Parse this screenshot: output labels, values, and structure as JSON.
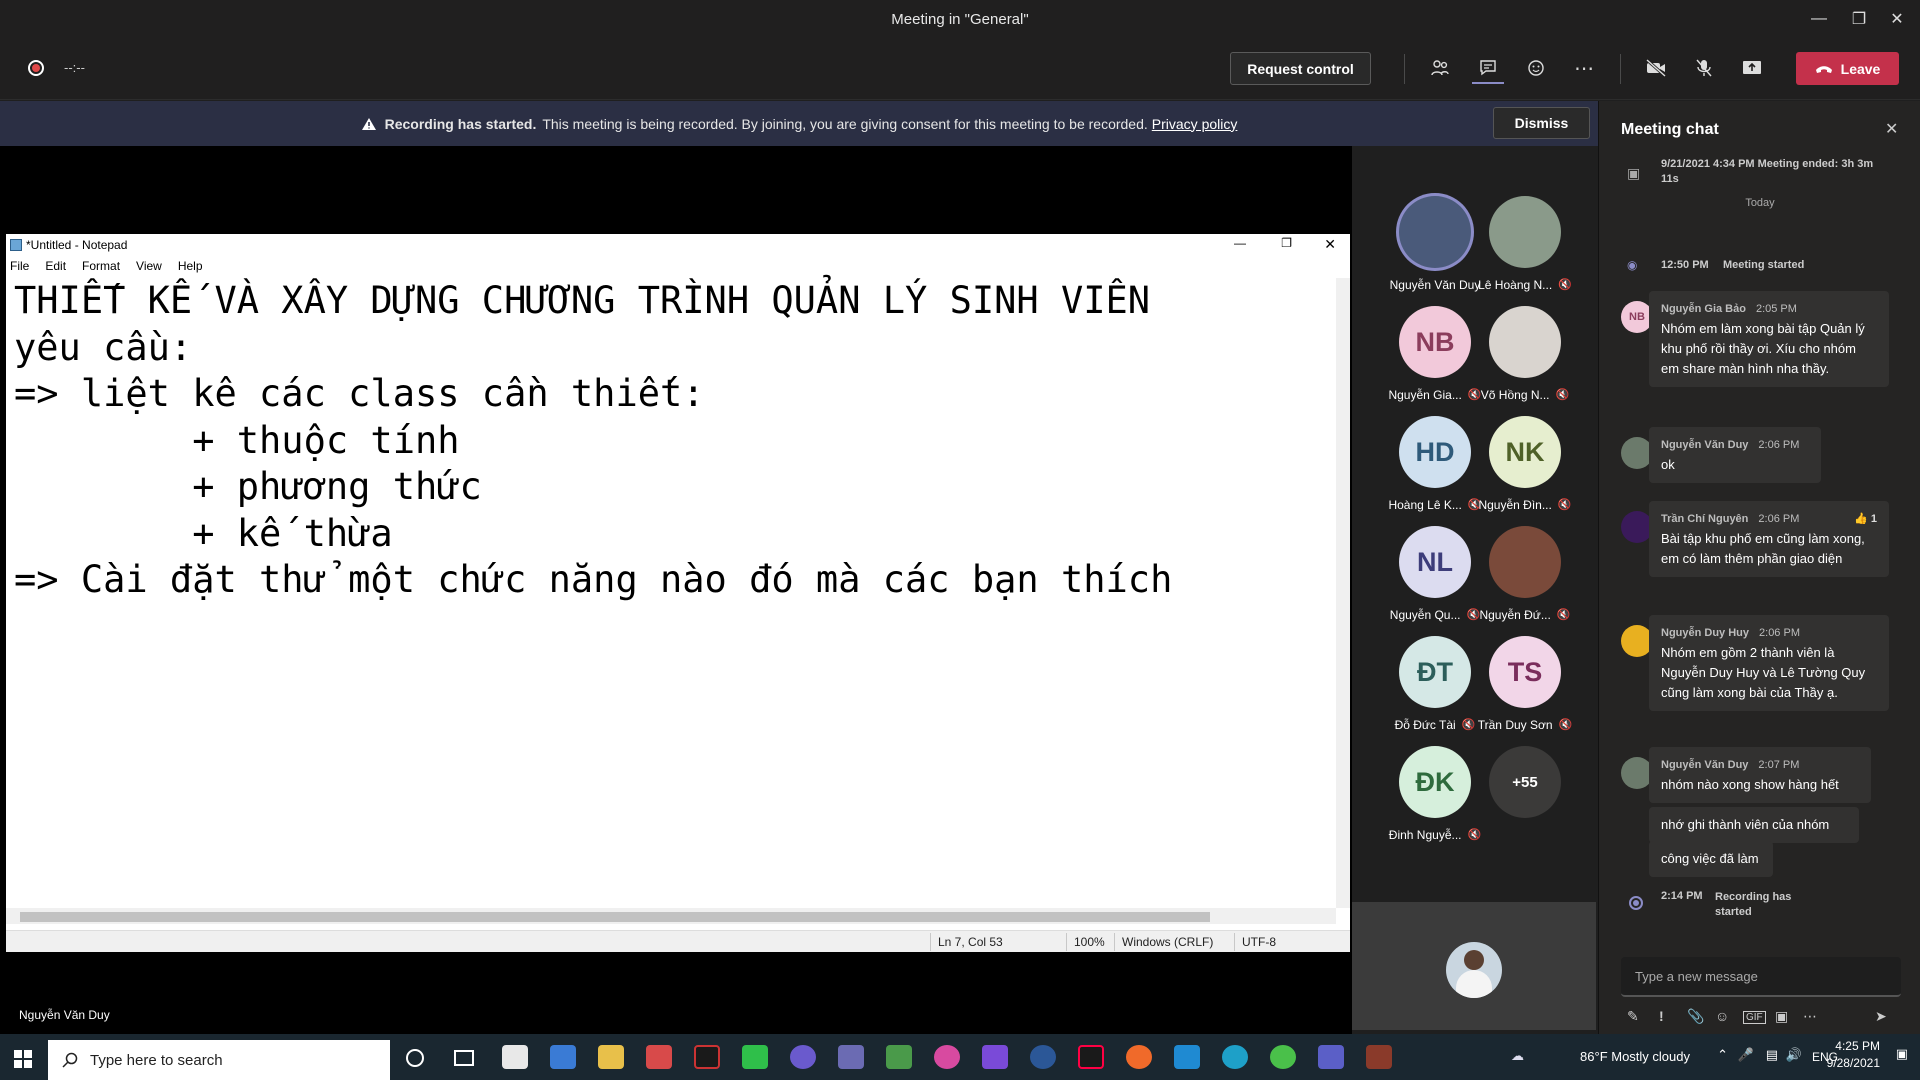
{
  "window": {
    "title": "Meeting in \"General\""
  },
  "toolbar": {
    "timer": "--:--",
    "request_control": "Request control",
    "leave": "Leave"
  },
  "banner": {
    "bold": "Recording has started.",
    "text": "This meeting is being recorded. By joining, you are giving consent for this meeting to be recorded.",
    "link": "Privacy policy",
    "dismiss": "Dismiss"
  },
  "notepad": {
    "title": "*Untitled - Notepad",
    "menu": [
      "File",
      "Edit",
      "Format",
      "View",
      "Help"
    ],
    "lines": [
      "THIẾT KẾ VÀ XÂY DỰNG CHƯƠNG TRÌNH QUẢN LÝ SINH VIÊN",
      "yêu cầu:",
      "=> liệt kê các class cần thiết:",
      "        + thuộc tính",
      "        + phương thức",
      "        + kế thừa",
      "=> Cài đặt thử một chức năng nào đó mà các bạn thích"
    ],
    "status": {
      "position": "Ln 7, Col 53",
      "zoom": "100%",
      "eol": "Windows (CRLF)",
      "encoding": "UTF-8"
    }
  },
  "presenter_name": "Nguyễn Văn Duy",
  "participants": [
    {
      "name": "Nguyễn Văn Duy",
      "initials": "",
      "bg": "#4a5a7a",
      "muted": false
    },
    {
      "name": "Lê Hoàng N...",
      "initials": "",
      "bg": "#8a9a8a",
      "muted": true
    },
    {
      "name": "Nguyễn Gia...",
      "initials": "NB",
      "bg": "#f2c9da",
      "fg": "#8b3d5c",
      "muted": true
    },
    {
      "name": "Võ Hồng N...",
      "initials": "",
      "bg": "#d9d4cf",
      "muted": true
    },
    {
      "name": "Hoàng Lê K...",
      "initials": "HD",
      "bg": "#cfe0ef",
      "fg": "#2e5a7a",
      "muted": true
    },
    {
      "name": "Nguyễn Đìn...",
      "initials": "NK",
      "bg": "#e6eecf",
      "fg": "#4f6128",
      "muted": true
    },
    {
      "name": "Nguyễn Qu...",
      "initials": "NL",
      "bg": "#dcdcf0",
      "fg": "#3d3d7a",
      "muted": true
    },
    {
      "name": "Nguyễn Đứ...",
      "initials": "",
      "bg": "#7a4a3a",
      "muted": true
    },
    {
      "name": "Đỗ Đức Tài",
      "initials": "ĐT",
      "bg": "#d5e8e6",
      "fg": "#2c5e5a",
      "muted": true
    },
    {
      "name": "Trần Duy Sơn",
      "initials": "TS",
      "bg": "#f2d6e8",
      "fg": "#7a2d5c",
      "muted": true
    },
    {
      "name": "Đinh Nguyễ...",
      "initials": "ĐK",
      "bg": "#d6efdc",
      "fg": "#2e6b3d",
      "muted": true
    },
    {
      "name": "",
      "initials": "+55",
      "bg": "#3b3a39",
      "fg": "#ffffff",
      "muted": false
    }
  ],
  "chat": {
    "header": "Meeting chat",
    "system1": "9/21/2021 4:34 PM   Meeting ended: 3h 3m 11s",
    "today": "Today",
    "system2_time": "12:50 PM",
    "system2_text": "Meeting started",
    "messages": [
      {
        "sender": "Nguyễn Gia Bảo",
        "time": "2:05 PM",
        "avatar": "NB",
        "text": "Nhóm em làm xong bài tập Quản lý khu phố rồi thầy ơi. Xíu cho nhóm em share màn hình nha thầy."
      },
      {
        "sender": "Nguyễn Văn Duy",
        "time": "2:06 PM",
        "avatar": "",
        "text": "ok"
      },
      {
        "sender": "Trần Chí Nguyên",
        "time": "2:06 PM",
        "avatar": "",
        "text": "Bài tập khu phố em cũng làm xong, em có làm thêm phần giao diện",
        "reaction": "1"
      },
      {
        "sender": "Nguyễn Duy Huy",
        "time": "2:06 PM",
        "avatar": "",
        "text": "Nhóm em gồm 2 thành viên là Nguyễn Duy Huy và Lê Tường Quy cũng làm xong bài của Thầy ạ."
      },
      {
        "sender": "Nguyễn Văn Duy",
        "time": "2:07 PM",
        "avatar": "",
        "text": "nhóm nào xong show hàng hết"
      }
    ],
    "followups": [
      "nhớ ghi thành viên của nhóm",
      "công việc đã làm"
    ],
    "system3_time": "2:14 PM",
    "system3_text": "Recording has started",
    "compose_placeholder": "Type a new message"
  },
  "taskbar": {
    "search_placeholder": "Type here to search",
    "weather": "86°F  Mostly cloudy",
    "lang": "ENG",
    "time": "4:25 PM",
    "date": "9/28/2021"
  }
}
